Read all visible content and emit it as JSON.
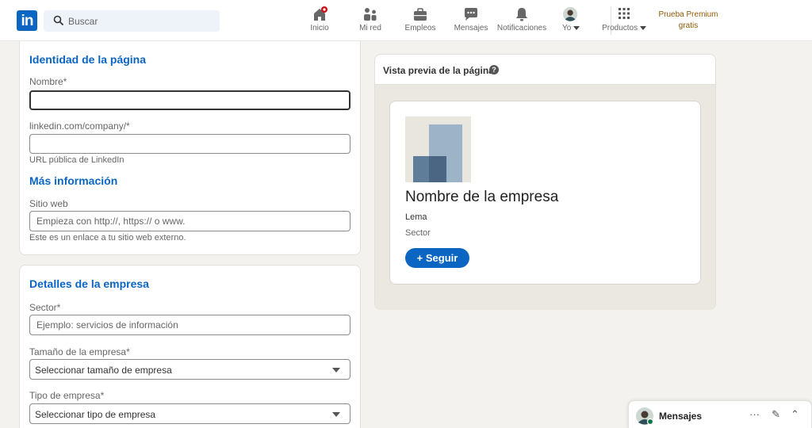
{
  "nav": {
    "search_placeholder": "Buscar",
    "items": [
      {
        "label": "Inicio",
        "icon": "home-icon"
      },
      {
        "label": "Mi red",
        "icon": "network-icon"
      },
      {
        "label": "Empleos",
        "icon": "briefcase-icon"
      },
      {
        "label": "Mensajes",
        "icon": "chat-icon"
      },
      {
        "label": "Notificaciones",
        "icon": "bell-icon"
      },
      {
        "label": "Yo",
        "icon": "avatar-icon"
      },
      {
        "label": "Productos",
        "icon": "grid-icon"
      }
    ],
    "premium": [
      "Prueba Premium",
      "gratis"
    ],
    "brand_color": "#0a66c2"
  },
  "identity": {
    "title": "Identidad de la página",
    "name_label": "Nombre*",
    "name_value": "",
    "url_label": "linkedin.com/company/*",
    "url_value": "",
    "url_hint": "URL pública de LinkedIn"
  },
  "more_info": {
    "title": "Más información",
    "website_label": "Sitio web",
    "website_placeholder": "Empieza con http://, https:// o www.",
    "website_hint": "Este es un enlace a tu sitio web externo."
  },
  "details": {
    "title": "Detalles de la empresa",
    "sector_label": "Sector*",
    "sector_placeholder": "Ejemplo: servicios de información",
    "size_label": "Tamaño de la empresa*",
    "size_selected": "Seleccionar tamaño de empresa",
    "type_label": "Tipo de empresa*",
    "type_selected": "Seleccionar tipo de empresa"
  },
  "preview": {
    "title": "Vista previa de la página",
    "company_name": "Nombre de la empresa",
    "tagline": "Lema",
    "sector": "Sector",
    "follow_label": "+ Seguir"
  },
  "messaging": {
    "label": "Mensajes",
    "more": "···",
    "compose": "✎",
    "collapse": "⌃"
  }
}
